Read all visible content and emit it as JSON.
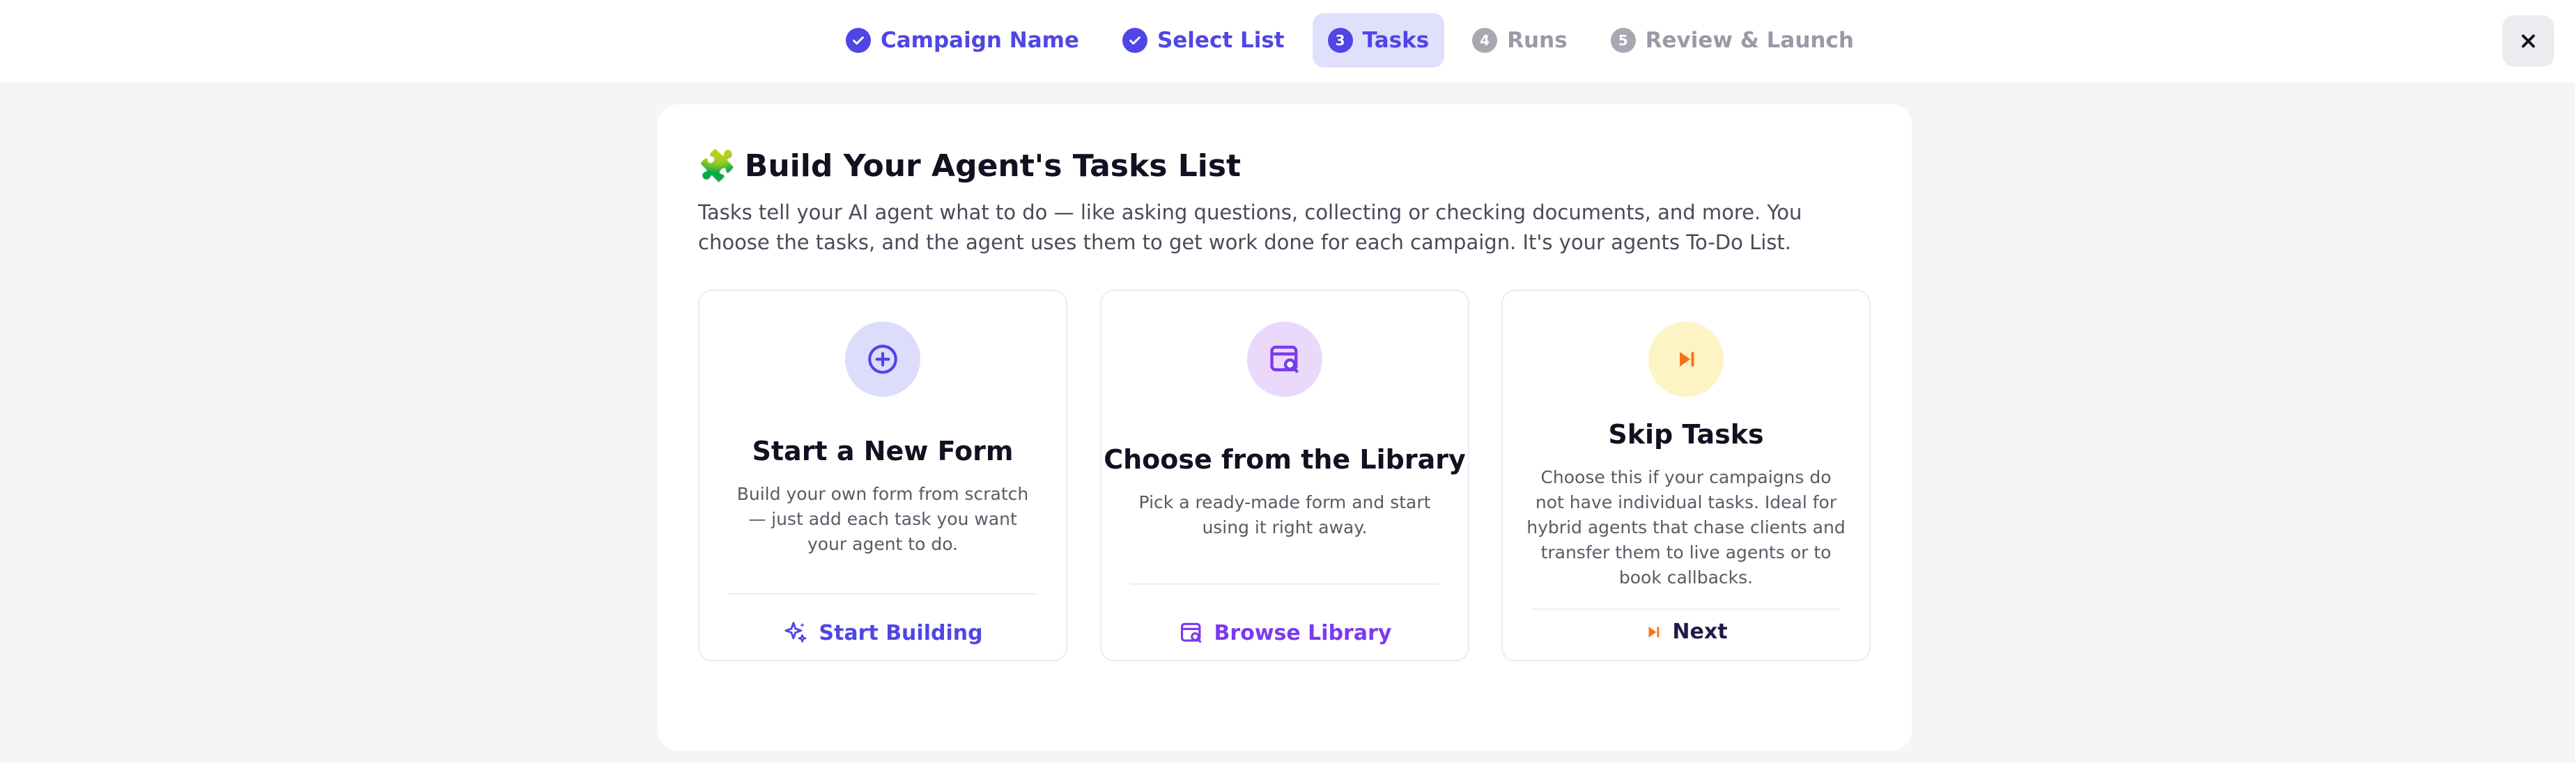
{
  "wizard": {
    "steps": [
      {
        "number": "1",
        "label": "Campaign Name",
        "state": "done"
      },
      {
        "number": "2",
        "label": "Select List",
        "state": "done"
      },
      {
        "number": "3",
        "label": "Tasks",
        "state": "active"
      },
      {
        "number": "4",
        "label": "Runs",
        "state": "todo"
      },
      {
        "number": "5",
        "label": "Review & Launch",
        "state": "todo"
      }
    ],
    "close_icon": "close-icon"
  },
  "page": {
    "emoji": "🧩",
    "title": "Build Your Agent's Tasks List",
    "description": "Tasks tell your AI agent what to do — like asking questions, collecting or checking documents, and more. You choose the tasks, and the agent uses them to get work done for each campaign. It's your agents To-Do List."
  },
  "cards": [
    {
      "title": "Start a New Form",
      "description": "Build your own form from scratch — just add each task you want your agent to do.",
      "action_label": "Start Building",
      "icon": "plus-circle-icon",
      "action_icon": "sparkles-icon",
      "icon_bg": "#dedcfb",
      "accent": "#4f46e5"
    },
    {
      "title": "Choose from the Library",
      "description": "Pick a ready-made form and start using it right away.",
      "action_label": "Browse Library",
      "icon": "library-search-icon",
      "action_icon": "library-search-icon",
      "icon_bg": "#ead9fb",
      "accent": "#7c3aed"
    },
    {
      "title": "Skip Tasks",
      "description": "Choose this if your campaigns do not have individual tasks. Ideal for hybrid agents that chase clients and transfer them to live agents or to book callbacks.",
      "action_label": "Next",
      "icon": "skip-forward-icon",
      "action_icon": "skip-forward-icon",
      "icon_bg": "#fdf3c4",
      "accent": "#f97316"
    }
  ],
  "colors": {
    "primary": "#4f46e5",
    "library": "#7c3aed",
    "skip": "#f97316",
    "text_dark": "#1e1b4b"
  }
}
